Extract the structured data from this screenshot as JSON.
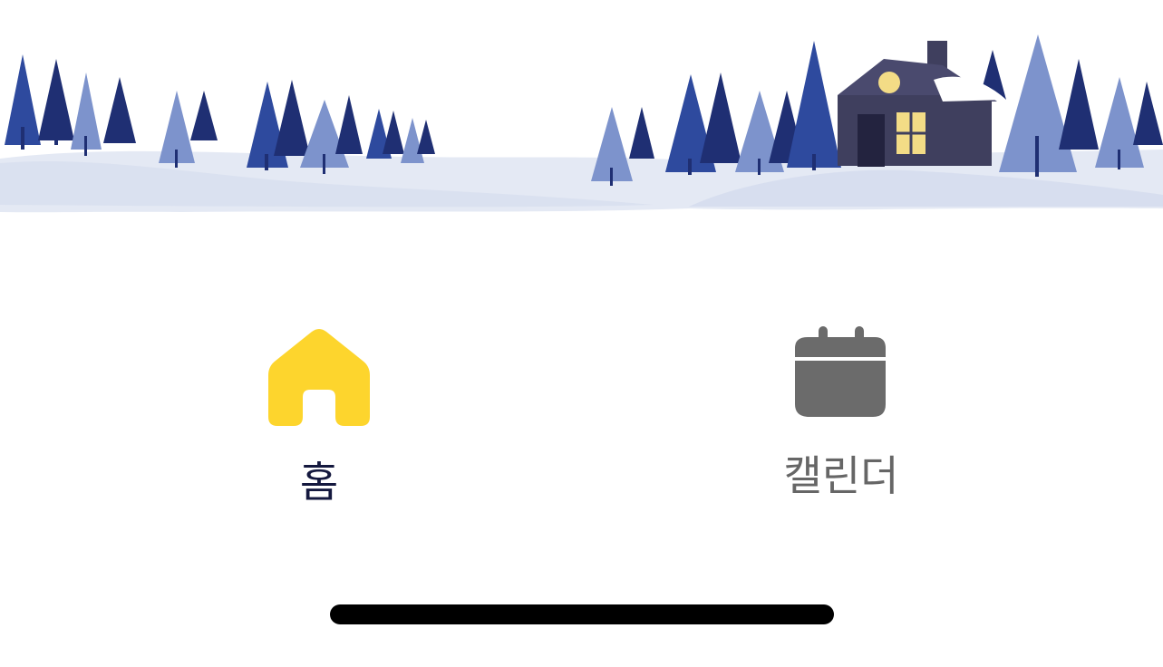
{
  "banner": {
    "illustration": "winter-snow-forest-with-house",
    "colors": {
      "tree_dark": "#1f2f73",
      "tree_mid": "#2e4a9e",
      "tree_light": "#7d93cc",
      "snow": "#e4e9f4",
      "house": "#3f3f5e",
      "window": "#f3dc86"
    }
  },
  "tab_bar": {
    "selected_tab": "home",
    "tabs": [
      {
        "id": "home",
        "label": "홈",
        "icon": "home-icon",
        "active": true,
        "color": "#fdd52d",
        "label_color": "#14183e"
      },
      {
        "id": "calendar",
        "label": "캘린더",
        "icon": "calendar-icon",
        "active": false,
        "color": "#6b6b6b",
        "label_color": "#666666"
      }
    ]
  },
  "home_indicator": {
    "color": "#000000"
  }
}
